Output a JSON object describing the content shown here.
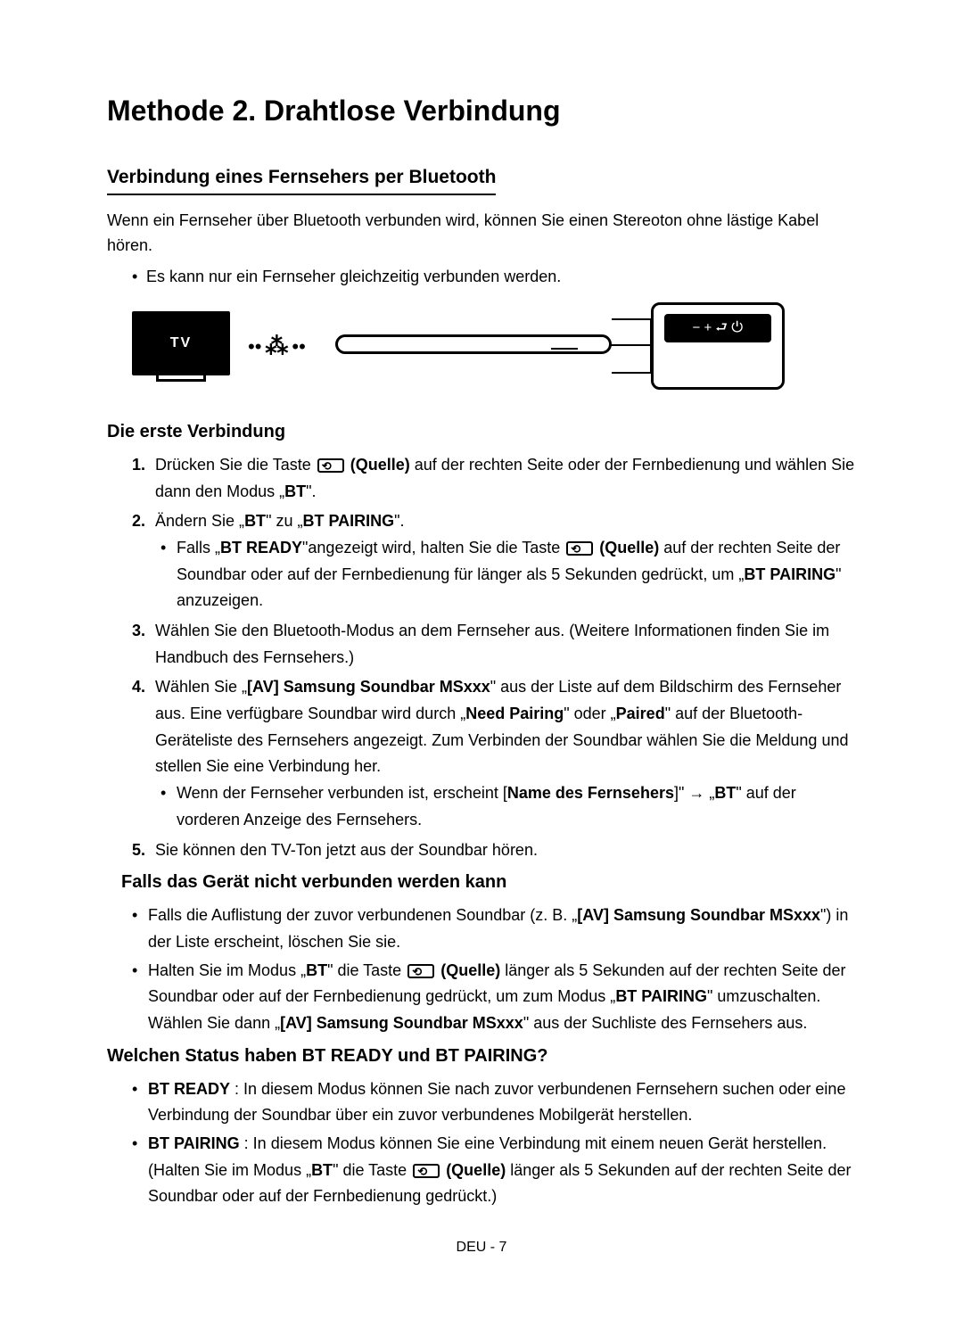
{
  "heading": "Methode 2. Drahtlose Verbindung",
  "section1": {
    "title": "Verbindung eines Fernsehers per Bluetooth",
    "intro": "Wenn ein Fernseher über Bluetooth verbunden wird, können Sie einen Stereoton ohne lästige Kabel hören.",
    "bullet": "Es kann nur ein Fernseher gleichzeitig verbunden werden."
  },
  "illustration": {
    "tv_label": "TV",
    "control_symbols": "−  +  ⮐  ⏻"
  },
  "first_connection": {
    "title": "Die erste Verbindung",
    "step1_a": "Drücken Sie die Taste ",
    "step1_b": " (Quelle)",
    "step1_c": " auf der rechten Seite oder der Fernbedienung und wählen Sie dann den Modus „",
    "step1_d": "BT",
    "step1_e": "\".",
    "step2_a": "Ändern Sie „",
    "step2_b": "BT",
    "step2_c": "\" zu „",
    "step2_d": "BT PAIRING",
    "step2_e": "\".",
    "step2_sub_a": "Falls „",
    "step2_sub_b": "BT READY",
    "step2_sub_c": "\"angezeigt wird, halten Sie die Taste ",
    "step2_sub_d": " (Quelle)",
    "step2_sub_e": " auf der rechten Seite der Soundbar oder auf der Fernbedienung für länger als 5 Sekunden gedrückt, um „",
    "step2_sub_f": "BT PAIRING",
    "step2_sub_g": "\" anzuzeigen.",
    "step3": "Wählen Sie den Bluetooth-Modus an dem Fernseher aus. (Weitere Informationen finden Sie im Handbuch des Fernsehers.)",
    "step4_a": "Wählen Sie „",
    "step4_b": "[AV] Samsung Soundbar MSxxx",
    "step4_c": "\" aus der Liste auf dem Bildschirm des Fernseher aus. Eine verfügbare Soundbar wird durch „",
    "step4_d": "Need Pairing",
    "step4_e": "\" oder „",
    "step4_f": "Paired",
    "step4_g": "\" auf der Bluetooth-Geräteliste des Fernsehers angezeigt. Zum Verbinden der Soundbar wählen Sie die Meldung und stellen Sie eine Verbindung her.",
    "step4_sub_a": "Wenn der Fernseher verbunden ist, erscheint [",
    "step4_sub_b": "Name des Fernsehers",
    "step4_sub_c": "]\" → „",
    "step4_sub_d": "BT",
    "step4_sub_e": "\" auf der vorderen Anzeige des Fernsehers.",
    "step5": "Sie können den TV-Ton jetzt aus der Soundbar hören."
  },
  "troubleshoot": {
    "title": "Falls das Gerät nicht verbunden werden kann",
    "b1_a": "Falls die Auflistung der zuvor verbundenen Soundbar (z. B. „",
    "b1_b": "[AV] Samsung Soundbar MSxxx",
    "b1_c": "\") in der Liste erscheint, löschen Sie sie.",
    "b2_a": "Halten Sie im Modus „",
    "b2_b": "BT",
    "b2_c": "\" die Taste ",
    "b2_d": " (Quelle)",
    "b2_e": " länger als 5 Sekunden auf der rechten Seite der Soundbar oder auf der Fernbedienung gedrückt, um zum Modus „",
    "b2_f": "BT PAIRING",
    "b2_g": "\" umzuschalten. Wählen Sie dann „",
    "b2_h": "[AV] Samsung Soundbar MSxxx",
    "b2_i": "\" aus der Suchliste des Fernsehers aus."
  },
  "status": {
    "title": "Welchen Status haben BT READY und BT PAIRING?",
    "b1_a": "BT READY",
    "b1_b": " : In diesem Modus können Sie nach zuvor verbundenen Fernsehern suchen oder eine Verbindung der Soundbar über ein zuvor verbundenes Mobilgerät herstellen.",
    "b2_a": "BT PAIRING",
    "b2_b": " : In diesem Modus können Sie eine Verbindung mit einem neuen Gerät herstellen. (Halten Sie im Modus „",
    "b2_c": "BT",
    "b2_d": "\" die Taste ",
    "b2_e": " (Quelle)",
    "b2_f": " länger als 5 Sekunden auf der rechten Seite der Soundbar oder auf der Fernbedienung gedrückt.)"
  },
  "footer": "DEU - 7"
}
